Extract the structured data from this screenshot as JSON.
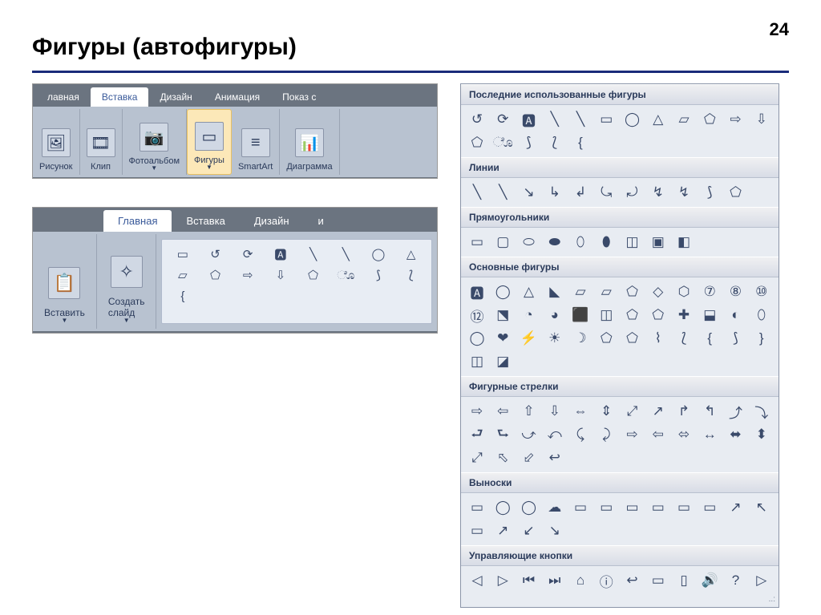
{
  "page_number": "24",
  "page_title": "Фигуры (автофигуры)",
  "ribbon1": {
    "tabs": [
      "лавная",
      "Вставка",
      "Дизайн",
      "Анимация",
      "Показ с"
    ],
    "active_tab": 1,
    "tools": [
      "Рисунок",
      "Клип",
      "Фотоальбом",
      "Фигуры",
      "SmartArt",
      "Диаграмма"
    ],
    "active_tool": 3,
    "tool_icons": [
      "🖼",
      "🎞",
      "📷",
      "▭",
      "≡",
      "📊"
    ]
  },
  "ribbon2": {
    "tabs": [
      "Главная",
      "Вставка",
      "Дизайн",
      "и"
    ],
    "active_tab": 0,
    "tools": [
      "Вставить",
      "Создать слайд"
    ],
    "tool_icons": [
      "📋",
      "✧"
    ],
    "mini_shapes": [
      "▭",
      "↺",
      "⟳",
      "🅰",
      "╲",
      "╲",
      "◯",
      "△",
      "▱",
      "⬠",
      "⇨",
      "⇩",
      "⬠",
      "ೊ",
      "⟆",
      "⟅",
      "{"
    ]
  },
  "shapes_panel": {
    "sections": [
      {
        "title": "Последние использованные фигуры",
        "cols": 12,
        "shapes": [
          "↺",
          "⟳",
          "🅰",
          "╲",
          "╲",
          "▭",
          "◯",
          "△",
          "▱",
          "⬠",
          "⇨",
          "⇩",
          "⬠",
          "ೊ",
          "⟆",
          "⟅",
          "{"
        ]
      },
      {
        "title": "Линии",
        "cols": 12,
        "shapes": [
          "╲",
          "╲",
          "↘",
          "↳",
          "↲",
          "⤿",
          "⤾",
          "↯",
          "↯",
          "⟆",
          "⬠"
        ]
      },
      {
        "title": "Прямоугольники",
        "cols": 12,
        "shapes": [
          "▭",
          "▢",
          "⬭",
          "⬬",
          "⬯",
          "⬮",
          "◫",
          "▣",
          "◧"
        ]
      },
      {
        "title": "Основные фигуры",
        "cols": 12,
        "shapes": [
          "🅰",
          "◯",
          "△",
          "◣",
          "▱",
          "▱",
          "⬠",
          "◇",
          "⬡",
          "⑦",
          "⑧",
          "⑩",
          "⑫",
          "⬔",
          "◔",
          "◕",
          "⬛",
          "◫",
          "⬠",
          "⬠",
          "✚",
          "⬓",
          "◐",
          "⬯",
          "◯",
          "❤",
          "⚡",
          "☀",
          "☽",
          "⬠",
          "⬠",
          "⌇",
          "⟅",
          "{",
          "⟆",
          "}",
          "◫",
          "◪"
        ]
      },
      {
        "title": "Фигурные стрелки",
        "cols": 12,
        "shapes": [
          "⇨",
          "⇦",
          "⇧",
          "⇩",
          "⇔",
          "⇕",
          "⤢",
          "↗",
          "↱",
          "↰",
          "⤴",
          "⤵",
          "⮐",
          "⮑",
          "⤻",
          "⤺",
          "⤹",
          "⤸",
          "⇨",
          "⇦",
          "⬄",
          "↔",
          "⬌",
          "⬍",
          "⤢",
          "⬁",
          "⬃",
          "↩"
        ]
      },
      {
        "title": "Выноски",
        "cols": 12,
        "shapes": [
          "▭",
          "◯",
          "◯",
          "☁",
          "▭",
          "▭",
          "▭",
          "▭",
          "▭",
          "▭",
          "↗",
          "↖",
          "▭",
          "↗",
          "↙",
          "↘"
        ]
      },
      {
        "title": "Управляющие кнопки",
        "cols": 12,
        "shapes": [
          "◁",
          "▷",
          "⏮",
          "⏭",
          "⌂",
          "ⓘ",
          "↩",
          "▭",
          "▯",
          "🔊",
          "?",
          "▷"
        ]
      }
    ]
  }
}
